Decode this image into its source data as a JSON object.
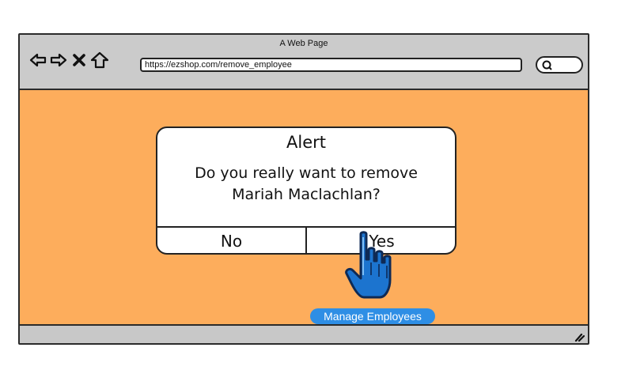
{
  "browser": {
    "title": "A Web Page",
    "url": "https://ezshop.com/remove_employee"
  },
  "alert": {
    "title": "Alert",
    "message_line1": "Do you really want to remove",
    "message_line2": "Mariah Maclachlan?",
    "no_label": "No",
    "yes_label": "Yes"
  },
  "footer": {
    "manage_button": "Manage Employees"
  },
  "colors": {
    "content_bg": "#fdad5c",
    "chrome_bg": "#c8c8c8",
    "accent_blue": "#2e8ee5"
  }
}
